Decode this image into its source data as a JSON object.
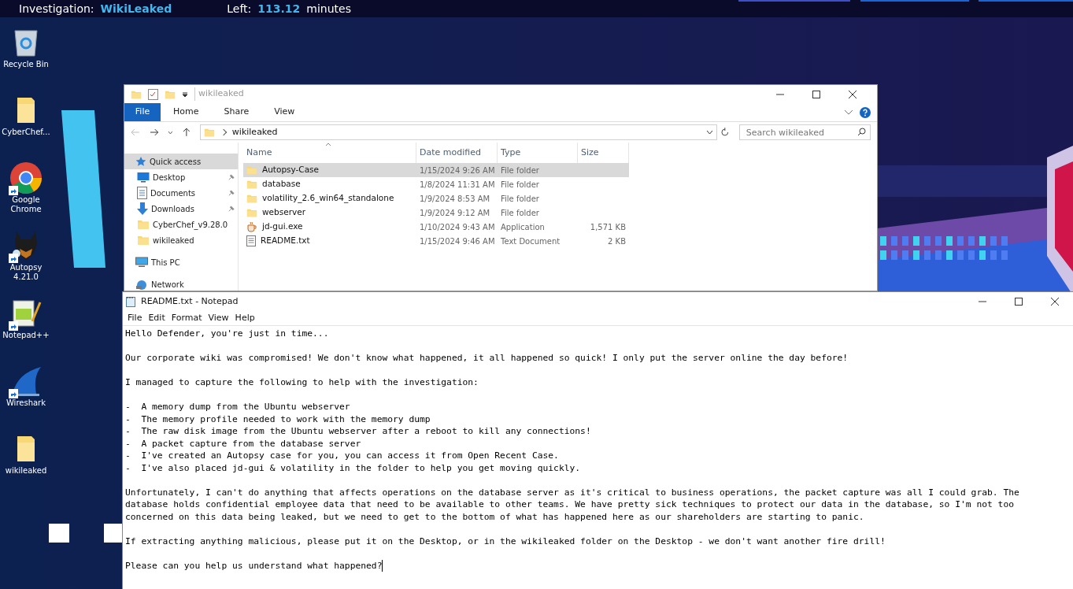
{
  "top_bar": {
    "investigation_label": "Investigation:",
    "investigation_name": "WikiLeaked",
    "time_label": "Left:",
    "time_value": "113.12",
    "time_unit": "minutes"
  },
  "desktop_icons": [
    {
      "kind": "recycle",
      "label": "Recycle Bin",
      "shortcut": false
    },
    {
      "kind": "folder",
      "label": "CyberChef...",
      "shortcut": false
    },
    {
      "kind": "chrome",
      "label": "Google Chrome",
      "shortcut": true
    },
    {
      "kind": "dog",
      "label": "Autopsy 4.21.0",
      "shortcut": true
    },
    {
      "kind": "notepad",
      "label": "Notepad++",
      "shortcut": true
    },
    {
      "kind": "fin",
      "label": "Wireshark",
      "shortcut": true
    },
    {
      "kind": "folder",
      "label": "wikileaked",
      "shortcut": false
    }
  ],
  "explorer": {
    "title": "wikileaked",
    "ribbon_tabs": [
      {
        "label": "File",
        "selected": true
      },
      {
        "label": "Home",
        "selected": false
      },
      {
        "label": "Share",
        "selected": false
      },
      {
        "label": "View",
        "selected": false
      }
    ],
    "breadcrumb": "wikileaked",
    "search": {
      "placeholder": "Search wikileaked"
    },
    "nav": [
      {
        "kind": "star",
        "label": "Quick access",
        "selected": true,
        "pinned": false,
        "children": [
          {
            "kind": "desktop",
            "label": "Desktop",
            "selected": false,
            "pinned": true
          },
          {
            "kind": "docs",
            "label": "Documents",
            "selected": false,
            "pinned": true
          },
          {
            "kind": "download",
            "label": "Downloads",
            "selected": false,
            "pinned": true
          },
          {
            "kind": "folder",
            "label": "CyberChef_v9.28.0",
            "selected": false,
            "pinned": false
          },
          {
            "kind": "folder",
            "label": "wikileaked",
            "selected": false,
            "pinned": false
          }
        ]
      },
      {
        "kind": "pc",
        "label": "This PC",
        "selected": false,
        "pinned": false
      },
      {
        "kind": "network",
        "label": "Network",
        "selected": false,
        "pinned": false
      }
    ],
    "columns": [
      "Name",
      "Date modified",
      "Type",
      "Size"
    ],
    "rows": [
      {
        "kind": "folder",
        "name": "Autopsy-Case",
        "date": "1/15/2024 9:26 AM",
        "type": "File folder",
        "selected": true
      },
      {
        "kind": "folder",
        "name": "database",
        "date": "1/8/2024 11:31 AM",
        "type": "File folder",
        "selected": false
      },
      {
        "kind": "folder",
        "name": "volatility_2.6_win64_standalone",
        "date": "1/9/2024 8:53 AM",
        "type": "File folder",
        "selected": false
      },
      {
        "kind": "folder",
        "name": "webserver",
        "date": "1/9/2024 9:12 AM",
        "type": "File folder",
        "selected": false
      },
      {
        "kind": "app",
        "name": "jd-gui.exe",
        "date": "1/10/2024 9:43 AM",
        "type": "Application",
        "size": "1,571 KB",
        "selected": false
      },
      {
        "kind": "text",
        "name": "README.txt",
        "date": "1/15/2024 9:46 AM",
        "type": "Text Document",
        "size": "2 KB",
        "selected": false
      }
    ]
  },
  "notepad": {
    "title": "README.txt - Notepad",
    "menu": [
      "File",
      "Edit",
      "Format",
      "View",
      "Help"
    ],
    "paragraphs": [
      [
        "Hello Defender, you're just in time..."
      ],
      [
        "Our corporate wiki was compromised! We don't know what happened, it all happened so quick! I only put the server online the day before!"
      ],
      [
        "I managed to capture the following to help with the investigation:"
      ],
      [
        "-  A memory dump from the Ubuntu webserver",
        "-  The memory profile needed to work with the memory dump",
        "-  The raw disk image from the Ubuntu webserver after a reboot to kill any connections!",
        "-  A packet capture from the database server",
        "-  I've created an Autopsy case for you, you can access it from Open Recent Case.",
        "-  I've also placed jd-gui & volatility in the folder to help you get moving quickly."
      ],
      [
        "Unfortunately, I can't do anything that affects operations on the database server as it's critical to business operations, the packet capture was all I could grab. The",
        "database holds confidential employee data that need to be available to other teams. We have pretty sick techniques to protect our data in the database, so I'm not too",
        "concerned on this data being leaked, but we need to get to the bottom of what has happened here as our shareholders are starting to panic."
      ],
      [
        "If extracting anything malicious, please put it on the Desktop, or in the wikileaked folder on the Desktop - we don't want another fire drill!"
      ],
      [
        "Please can you help us understand what happened?"
      ]
    ]
  }
}
